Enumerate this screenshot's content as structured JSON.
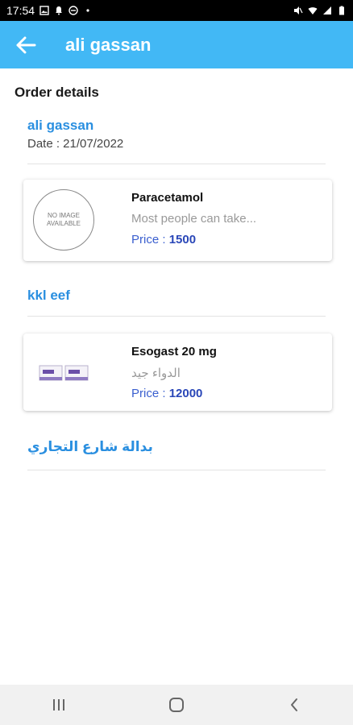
{
  "status_bar": {
    "time": "17:54"
  },
  "app_bar": {
    "title": "ali gassan"
  },
  "order": {
    "section_title": "Order details",
    "customer_name": "ali gassan",
    "date_text": "Date : 21/07/2022"
  },
  "groups": [
    {
      "store_name": "",
      "item": {
        "name": "Paracetamol",
        "description": "Most people can take...",
        "price_label": "Price : ",
        "price_value": "1500",
        "image": "no-image-placeholder",
        "placeholder_line1": "NO IMAGE",
        "placeholder_line2": "AVAILABLE"
      }
    },
    {
      "store_name": "kkl eef",
      "item": {
        "name": "Esogast 20 mg",
        "description": "الدواء جيد",
        "price_label": "Price : ",
        "price_value": "12000",
        "image": "medicine-box-photo"
      }
    },
    {
      "store_name": "بدالة شارع التجاري"
    }
  ],
  "colors": {
    "app_bar": "#42b8f5",
    "accent_link": "#2a8fe0",
    "price": "#2a47b8"
  }
}
